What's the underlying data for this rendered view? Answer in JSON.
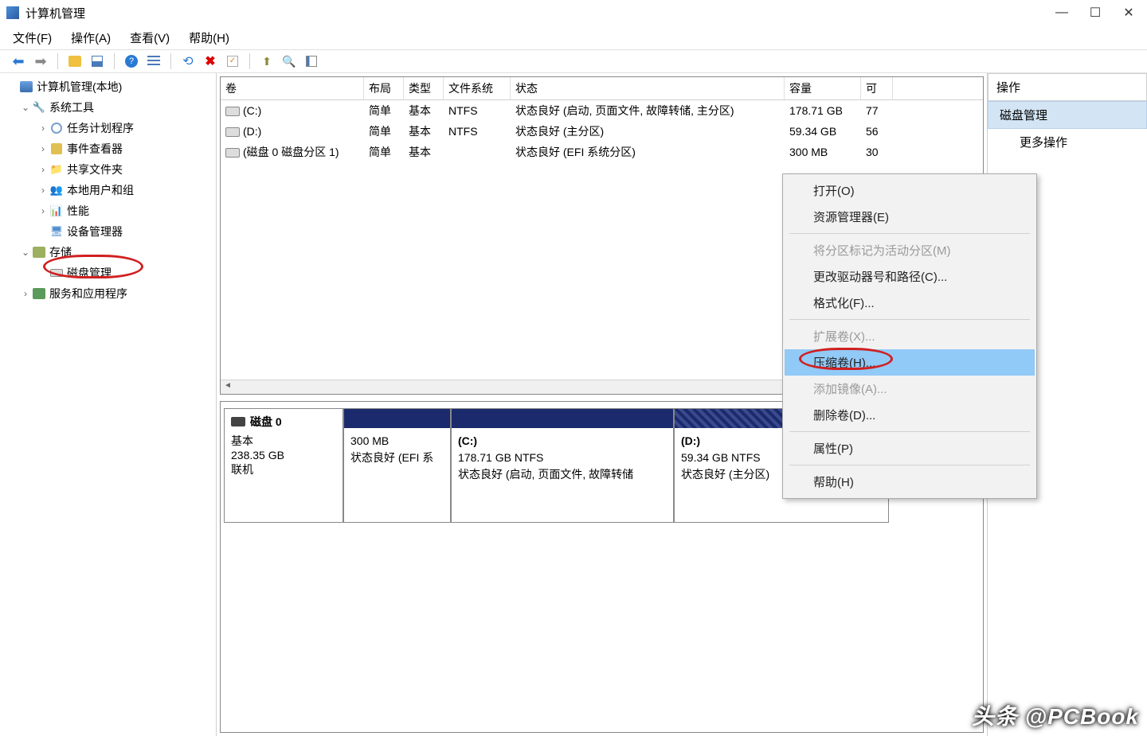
{
  "window": {
    "title": "计算机管理"
  },
  "menu": {
    "file": "文件(F)",
    "action": "操作(A)",
    "view": "查看(V)",
    "help": "帮助(H)"
  },
  "tree": {
    "root": "计算机管理(本地)",
    "system_tools": "系统工具",
    "task_scheduler": "任务计划程序",
    "event_viewer": "事件查看器",
    "shared_folders": "共享文件夹",
    "local_users": "本地用户和组",
    "performance": "性能",
    "device_manager": "设备管理器",
    "storage": "存储",
    "disk_management": "磁盘管理",
    "services": "服务和应用程序"
  },
  "table": {
    "headers": {
      "volume": "卷",
      "layout": "布局",
      "type": "类型",
      "fs": "文件系统",
      "status": "状态",
      "capacity": "容量",
      "free": "可"
    },
    "rows": [
      {
        "vol": "(C:)",
        "layout": "简单",
        "type": "基本",
        "fs": "NTFS",
        "status": "状态良好 (启动, 页面文件, 故障转储, 主分区)",
        "cap": "178.71 GB",
        "free": "77"
      },
      {
        "vol": "(D:)",
        "layout": "简单",
        "type": "基本",
        "fs": "NTFS",
        "status": "状态良好 (主分区)",
        "cap": "59.34 GB",
        "free": "56"
      },
      {
        "vol": "(磁盘 0 磁盘分区 1)",
        "layout": "简单",
        "type": "基本",
        "fs": "",
        "status": "状态良好 (EFI 系统分区)",
        "cap": "300 MB",
        "free": "30"
      }
    ]
  },
  "disk": {
    "name": "磁盘 0",
    "type": "基本",
    "size": "238.35 GB",
    "status": "联机",
    "partitions": [
      {
        "name": "",
        "size": "300 MB",
        "status": "状态良好 (EFI 系"
      },
      {
        "name": "(C:)",
        "size": "178.71 GB NTFS",
        "status": "状态良好 (启动, 页面文件, 故障转储"
      },
      {
        "name": "(D:)",
        "size": "59.34 GB NTFS",
        "status": "状态良好 (主分区)"
      }
    ]
  },
  "actions": {
    "header": "操作",
    "group": "磁盘管理",
    "more": "更多操作"
  },
  "context": {
    "open": "打开(O)",
    "explorer": "资源管理器(E)",
    "mark_active": "将分区标记为活动分区(M)",
    "change_letter": "更改驱动器号和路径(C)...",
    "format": "格式化(F)...",
    "extend": "扩展卷(X)...",
    "shrink": "压缩卷(H)...",
    "add_mirror": "添加镜像(A)...",
    "delete": "删除卷(D)...",
    "properties": "属性(P)",
    "help": "帮助(H)"
  },
  "watermark": "头条 @PCBook"
}
